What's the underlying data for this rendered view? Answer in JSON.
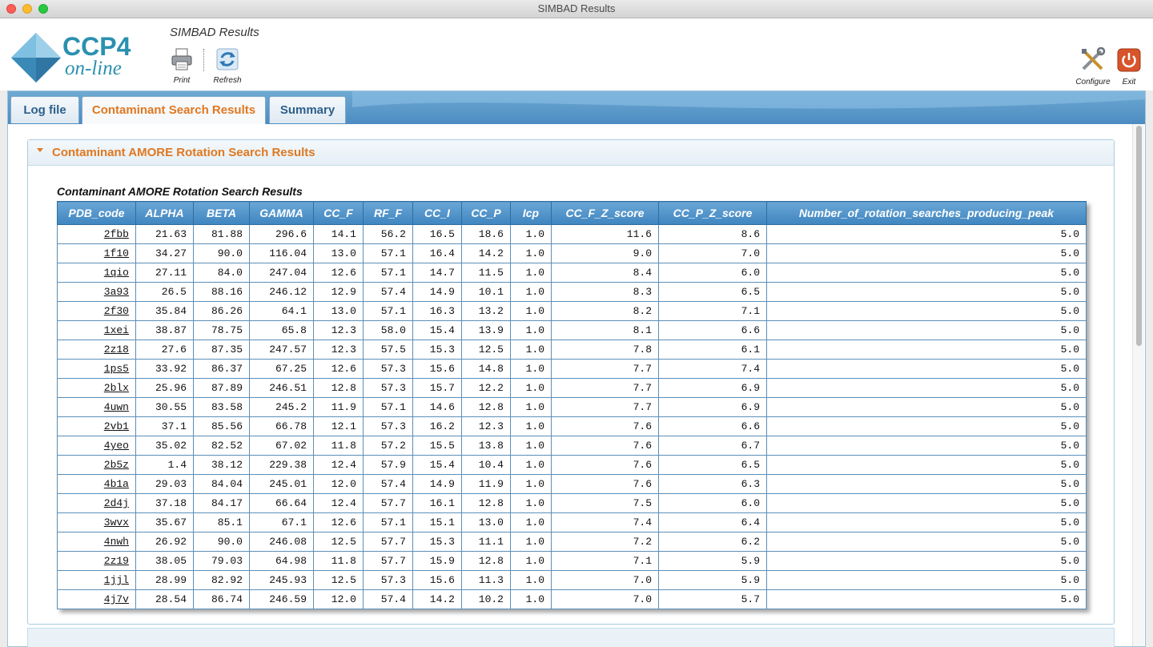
{
  "window": {
    "title": "SIMBAD Results"
  },
  "logo": {
    "name": "CCP4",
    "subtitle": "on-line"
  },
  "header": {
    "app_title": "SIMBAD Results"
  },
  "toolbar": {
    "print_label": "Print",
    "refresh_label": "Refresh",
    "configure_label": "Configure",
    "exit_label": "Exit"
  },
  "tabs": [
    {
      "label": "Log file",
      "active": false
    },
    {
      "label": "Contaminant Search Results",
      "active": true
    },
    {
      "label": "Summary",
      "active": false
    }
  ],
  "section": {
    "title": "Contaminant AMORE Rotation Search Results",
    "table_caption": "Contaminant AMORE Rotation Search Results"
  },
  "table": {
    "columns": [
      "PDB_code",
      "ALPHA",
      "BETA",
      "GAMMA",
      "CC_F",
      "RF_F",
      "CC_I",
      "CC_P",
      "Icp",
      "CC_F_Z_score",
      "CC_P_Z_score",
      "Number_of_rotation_searches_producing_peak"
    ],
    "rows": [
      [
        "2fbb",
        "21.63",
        "81.88",
        "296.6",
        "14.1",
        "56.2",
        "16.5",
        "18.6",
        "1.0",
        "11.6",
        "8.6",
        "5.0"
      ],
      [
        "1f10",
        "34.27",
        "90.0",
        "116.04",
        "13.0",
        "57.1",
        "16.4",
        "14.2",
        "1.0",
        "9.0",
        "7.0",
        "5.0"
      ],
      [
        "1qio",
        "27.11",
        "84.0",
        "247.04",
        "12.6",
        "57.1",
        "14.7",
        "11.5",
        "1.0",
        "8.4",
        "6.0",
        "5.0"
      ],
      [
        "3a93",
        "26.5",
        "88.16",
        "246.12",
        "12.9",
        "57.4",
        "14.9",
        "10.1",
        "1.0",
        "8.3",
        "6.5",
        "5.0"
      ],
      [
        "2f30",
        "35.84",
        "86.26",
        "64.1",
        "13.0",
        "57.1",
        "16.3",
        "13.2",
        "1.0",
        "8.2",
        "7.1",
        "5.0"
      ],
      [
        "1xei",
        "38.87",
        "78.75",
        "65.8",
        "12.3",
        "58.0",
        "15.4",
        "13.9",
        "1.0",
        "8.1",
        "6.6",
        "5.0"
      ],
      [
        "2z18",
        "27.6",
        "87.35",
        "247.57",
        "12.3",
        "57.5",
        "15.3",
        "12.5",
        "1.0",
        "7.8",
        "6.1",
        "5.0"
      ],
      [
        "1ps5",
        "33.92",
        "86.37",
        "67.25",
        "12.6",
        "57.3",
        "15.6",
        "14.8",
        "1.0",
        "7.7",
        "7.4",
        "5.0"
      ],
      [
        "2blx",
        "25.96",
        "87.89",
        "246.51",
        "12.8",
        "57.3",
        "15.7",
        "12.2",
        "1.0",
        "7.7",
        "6.9",
        "5.0"
      ],
      [
        "4uwn",
        "30.55",
        "83.58",
        "245.2",
        "11.9",
        "57.1",
        "14.6",
        "12.8",
        "1.0",
        "7.7",
        "6.9",
        "5.0"
      ],
      [
        "2vb1",
        "37.1",
        "85.56",
        "66.78",
        "12.1",
        "57.3",
        "16.2",
        "12.3",
        "1.0",
        "7.6",
        "6.6",
        "5.0"
      ],
      [
        "4yeo",
        "35.02",
        "82.52",
        "67.02",
        "11.8",
        "57.2",
        "15.5",
        "13.8",
        "1.0",
        "7.6",
        "6.7",
        "5.0"
      ],
      [
        "2b5z",
        "1.4",
        "38.12",
        "229.38",
        "12.4",
        "57.9",
        "15.4",
        "10.4",
        "1.0",
        "7.6",
        "6.5",
        "5.0"
      ],
      [
        "4b1a",
        "29.03",
        "84.04",
        "245.01",
        "12.0",
        "57.4",
        "14.9",
        "11.9",
        "1.0",
        "7.6",
        "6.3",
        "5.0"
      ],
      [
        "2d4j",
        "37.18",
        "84.17",
        "66.64",
        "12.4",
        "57.7",
        "16.1",
        "12.8",
        "1.0",
        "7.5",
        "6.0",
        "5.0"
      ],
      [
        "3wvx",
        "35.67",
        "85.1",
        "67.1",
        "12.6",
        "57.1",
        "15.1",
        "13.0",
        "1.0",
        "7.4",
        "6.4",
        "5.0"
      ],
      [
        "4nwh",
        "26.92",
        "90.0",
        "246.08",
        "12.5",
        "57.7",
        "15.3",
        "11.1",
        "1.0",
        "7.2",
        "6.2",
        "5.0"
      ],
      [
        "2z19",
        "38.05",
        "79.03",
        "64.98",
        "11.8",
        "57.7",
        "15.9",
        "12.8",
        "1.0",
        "7.1",
        "5.9",
        "5.0"
      ],
      [
        "1jjl",
        "28.99",
        "82.92",
        "245.93",
        "12.5",
        "57.3",
        "15.6",
        "11.3",
        "1.0",
        "7.0",
        "5.9",
        "5.0"
      ],
      [
        "4j7v",
        "28.54",
        "86.74",
        "246.59",
        "12.0",
        "57.4",
        "14.2",
        "10.2",
        "1.0",
        "7.0",
        "5.7",
        "5.0"
      ]
    ]
  },
  "colors": {
    "accent_orange": "#e07820",
    "header_blue": "#4b8cc2",
    "logo_blue": "#2a90b0"
  },
  "icons": [
    "printer-icon",
    "refresh-icon",
    "configure-tools-icon",
    "exit-power-icon",
    "ccp4-logo-gem-icon"
  ]
}
